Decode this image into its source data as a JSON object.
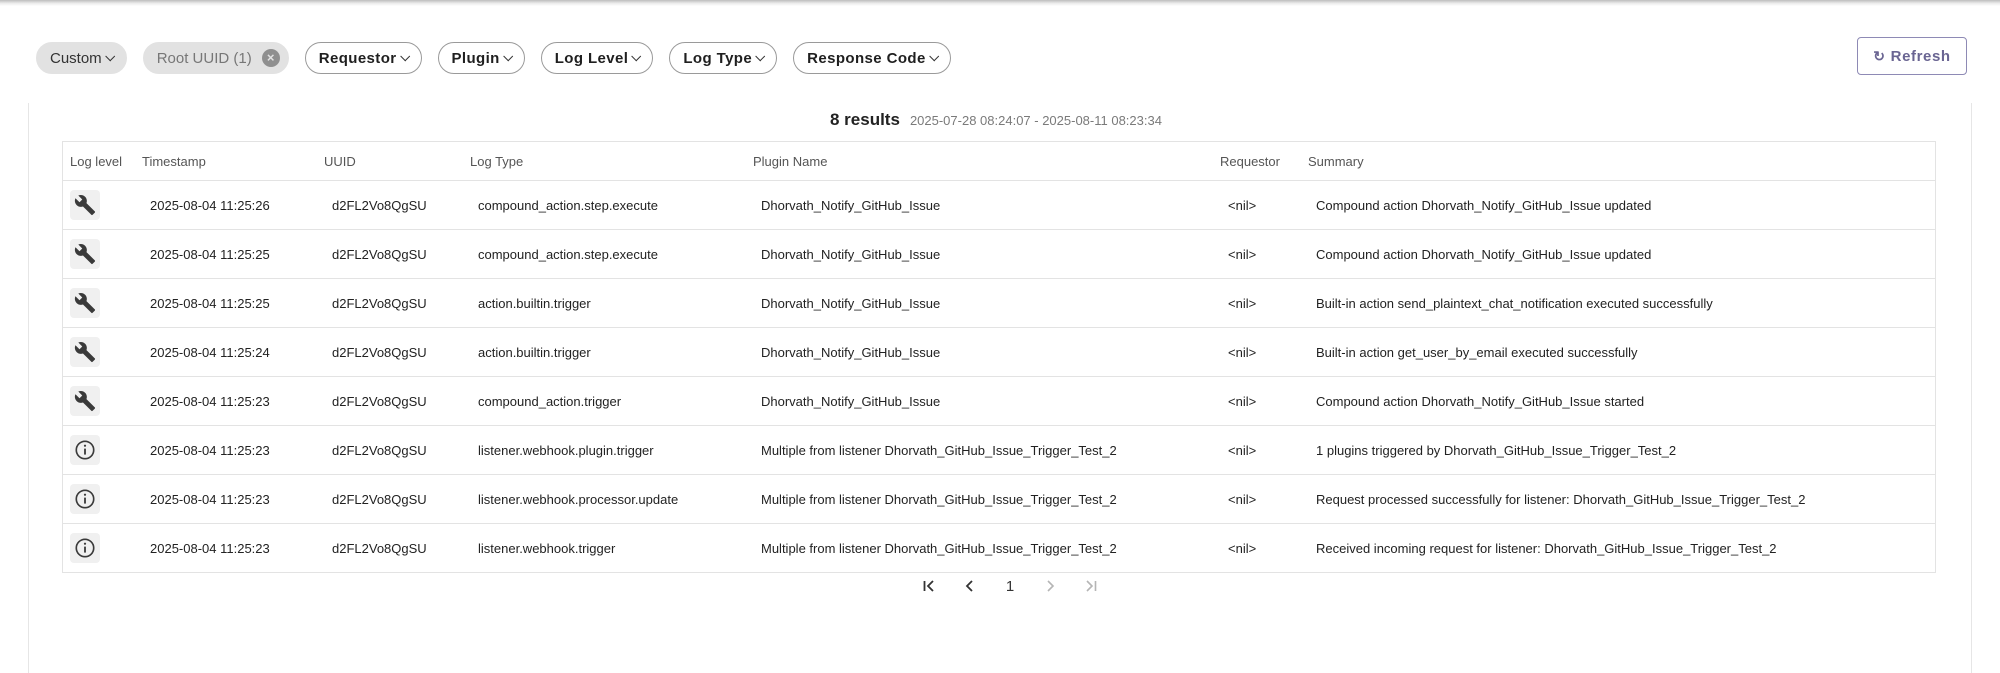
{
  "filters": {
    "custom": "Custom",
    "root_uuid": "Root UUID (1)",
    "requestor": "Requestor",
    "plugin": "Plugin",
    "log_level": "Log Level",
    "log_type": "Log Type",
    "response_code": "Response Code"
  },
  "refresh_label": "Refresh",
  "results": {
    "count": "8 results",
    "range": "2025-07-28 08:24:07 - 2025-08-11 08:23:34"
  },
  "table": {
    "headers": {
      "level": "Log level",
      "timestamp": "Timestamp",
      "uuid": "UUID",
      "type": "Log Type",
      "plugin": "Plugin Name",
      "requestor": "Requestor",
      "summary": "Summary"
    },
    "rows": [
      {
        "level_icon": "wrench-icon",
        "timestamp": "2025-08-04 11:25:26",
        "uuid": "d2FL2Vo8QgSU",
        "type": "compound_action.step.execute",
        "plugin": "Dhorvath_Notify_GitHub_Issue",
        "requestor": "<nil>",
        "summary": "Compound action Dhorvath_Notify_GitHub_Issue updated"
      },
      {
        "level_icon": "wrench-icon",
        "timestamp": "2025-08-04 11:25:25",
        "uuid": "d2FL2Vo8QgSU",
        "type": "compound_action.step.execute",
        "plugin": "Dhorvath_Notify_GitHub_Issue",
        "requestor": "<nil>",
        "summary": "Compound action Dhorvath_Notify_GitHub_Issue updated"
      },
      {
        "level_icon": "wrench-icon",
        "timestamp": "2025-08-04 11:25:25",
        "uuid": "d2FL2Vo8QgSU",
        "type": "action.builtin.trigger",
        "plugin": "Dhorvath_Notify_GitHub_Issue",
        "requestor": "<nil>",
        "summary": "Built-in action send_plaintext_chat_notification executed successfully"
      },
      {
        "level_icon": "wrench-icon",
        "timestamp": "2025-08-04 11:25:24",
        "uuid": "d2FL2Vo8QgSU",
        "type": "action.builtin.trigger",
        "plugin": "Dhorvath_Notify_GitHub_Issue",
        "requestor": "<nil>",
        "summary": "Built-in action get_user_by_email executed successfully"
      },
      {
        "level_icon": "wrench-icon",
        "timestamp": "2025-08-04 11:25:23",
        "uuid": "d2FL2Vo8QgSU",
        "type": "compound_action.trigger",
        "plugin": "Dhorvath_Notify_GitHub_Issue",
        "requestor": "<nil>",
        "summary": "Compound action Dhorvath_Notify_GitHub_Issue started"
      },
      {
        "level_icon": "info-icon",
        "timestamp": "2025-08-04 11:25:23",
        "uuid": "d2FL2Vo8QgSU",
        "type": "listener.webhook.plugin.trigger",
        "plugin": "Multiple from listener Dhorvath_GitHub_Issue_Trigger_Test_2",
        "requestor": "<nil>",
        "summary": "1 plugins triggered by Dhorvath_GitHub_Issue_Trigger_Test_2"
      },
      {
        "level_icon": "info-icon",
        "timestamp": "2025-08-04 11:25:23",
        "uuid": "d2FL2Vo8QgSU",
        "type": "listener.webhook.processor.update",
        "plugin": "Multiple from listener Dhorvath_GitHub_Issue_Trigger_Test_2",
        "requestor": "<nil>",
        "summary": "Request processed successfully for listener: Dhorvath_GitHub_Issue_Trigger_Test_2"
      },
      {
        "level_icon": "info-icon",
        "timestamp": "2025-08-04 11:25:23",
        "uuid": "d2FL2Vo8QgSU",
        "type": "listener.webhook.trigger",
        "plugin": "Multiple from listener Dhorvath_GitHub_Issue_Trigger_Test_2",
        "requestor": "<nil>",
        "summary": "Received incoming request for listener: Dhorvath_GitHub_Issue_Trigger_Test_2"
      }
    ]
  },
  "pagination": {
    "current_page": "1"
  }
}
